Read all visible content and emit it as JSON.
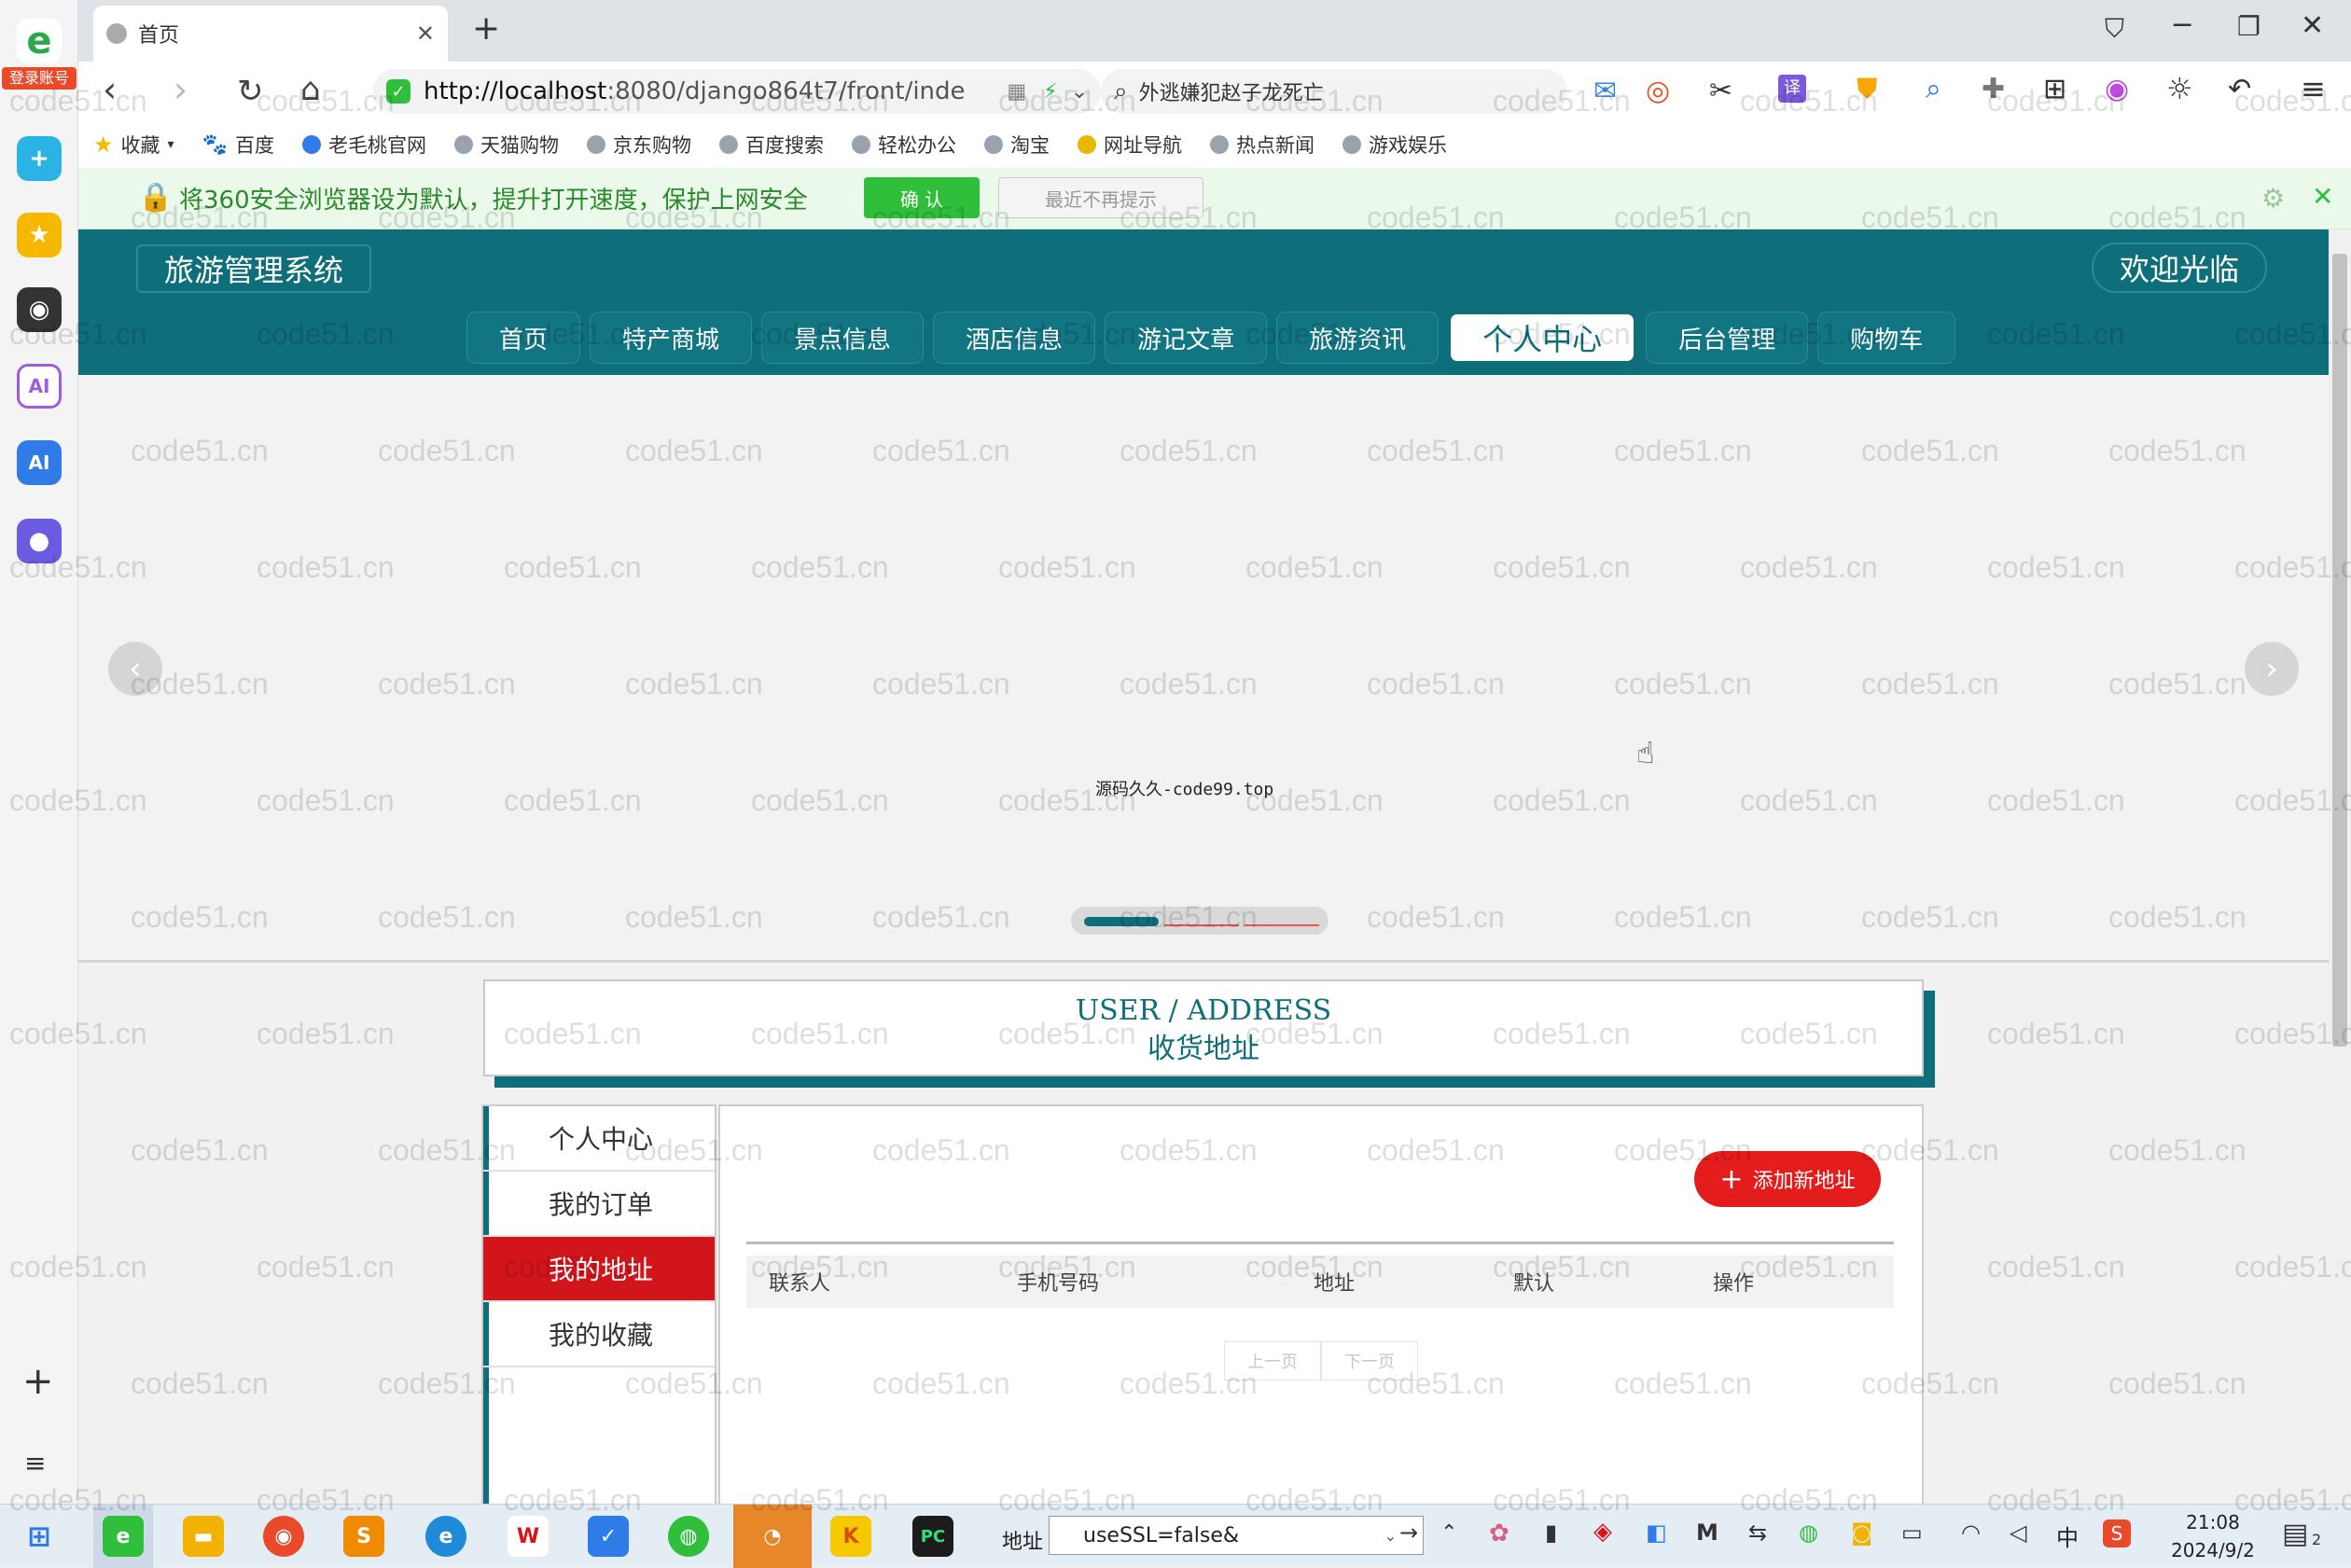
{
  "browser": {
    "tab_title": "首页",
    "new_tab": "+",
    "url_host": "http://localhost",
    "url_rest": ":8080/django864t7/front/inde",
    "search_text": "外逃嫌犯赵子龙死亡",
    "login_badge": "登录账号"
  },
  "bookmarks": [
    "收藏",
    "百度",
    "老毛桃官网",
    "天猫购物",
    "京东购物",
    "百度搜索",
    "轻松办公",
    "淘宝",
    "网址导航",
    "热点新闻",
    "游戏娱乐"
  ],
  "notification": {
    "text": "将360安全浏览器设为默认，提升打开速度，保护上网安全",
    "confirm": "确 认",
    "dismiss": "最近不再提示"
  },
  "site": {
    "title": "旅游管理系统",
    "welcome": "欢迎光临",
    "nav": [
      "首页",
      "特产商城",
      "景点信息",
      "酒店信息",
      "游记文章",
      "旅游资讯",
      "个人中心",
      "后台管理",
      "购物车"
    ],
    "active_nav": "个人中心",
    "banner_text": "源码久久-code99.top",
    "section_en": "USER / ADDRESS",
    "section_cn": "收货地址",
    "menu": [
      "个人中心",
      "我的订单",
      "我的地址",
      "我的收藏"
    ],
    "active_menu": "我的地址",
    "add_button": "添加新地址",
    "table_headers": [
      "联系人",
      "手机号码",
      "地址",
      "默认",
      "操作"
    ],
    "pager_prev": "上一页",
    "pager_next": "下一页"
  },
  "taskbar": {
    "address_label": "地址",
    "address_value": "useSSL=false&",
    "ime": "中",
    "time": "21:08",
    "date": "2024/9/2",
    "notification_count": "2"
  },
  "watermark": "code51.cn",
  "colors": {
    "brand": "#0e6e7a",
    "accent_red": "#e51c1c",
    "menu_active": "#d2141b",
    "confirm_green": "#2fbf3a"
  }
}
